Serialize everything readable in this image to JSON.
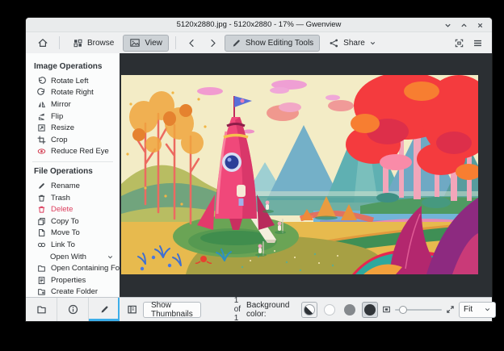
{
  "titlebar": {
    "title": "5120x2880.jpg - 5120x2880 - 17% — Gwenview"
  },
  "toolbar": {
    "browse": "Browse",
    "view": "View",
    "show_editing_tools": "Show Editing Tools",
    "share": "Share"
  },
  "sidebar": {
    "sections": [
      {
        "title": "Image Operations",
        "items": [
          {
            "label": "Rotate Left"
          },
          {
            "label": "Rotate Right"
          },
          {
            "label": "Mirror"
          },
          {
            "label": "Flip"
          },
          {
            "label": "Resize"
          },
          {
            "label": "Crop"
          },
          {
            "label": "Reduce Red Eye"
          }
        ]
      },
      {
        "title": "File Operations",
        "items": [
          {
            "label": "Rename"
          },
          {
            "label": "Trash"
          },
          {
            "label": "Delete"
          },
          {
            "label": "Copy To"
          },
          {
            "label": "Move To"
          },
          {
            "label": "Link To"
          },
          {
            "label": "Open With"
          },
          {
            "label": "Open Containing Folder"
          },
          {
            "label": "Properties"
          },
          {
            "label": "Create Folder"
          }
        ]
      }
    ]
  },
  "statusbar": {
    "show_thumbnails": "Show Thumbnails",
    "page_indicator": "1 of 1",
    "background_color_label": "Background color:",
    "zoom_mode": "Fit"
  },
  "colors": {
    "accent": "#3daee9",
    "delete_red": "#dc3d5c",
    "viewer_background": "#2b2f33",
    "window_background": "#eff0f1"
  }
}
